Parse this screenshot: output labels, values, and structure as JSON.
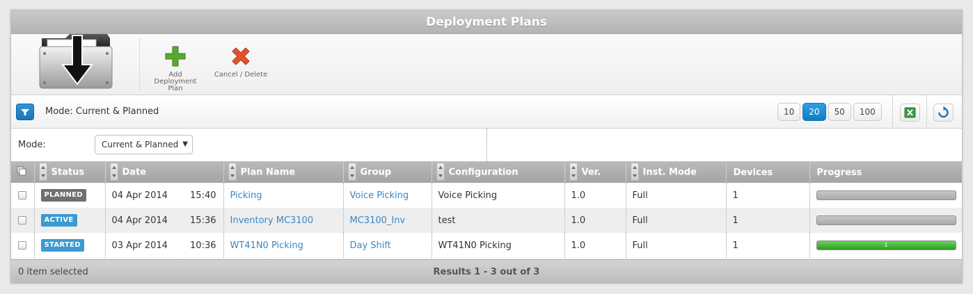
{
  "window": {
    "title": "Deployment Plans"
  },
  "toolbar": {
    "add_label": "Add Deployment Plan",
    "cancel_label": "Cancel / Delete"
  },
  "filter": {
    "mode_text": "Mode: Current & Planned",
    "page_sizes": [
      "10",
      "20",
      "50",
      "100"
    ],
    "active_page_size": "20"
  },
  "mode_filter": {
    "label": "Mode:",
    "selected": "Current & Planned"
  },
  "table": {
    "columns": [
      "Status",
      "Date",
      "Plan Name",
      "Group",
      "Configuration",
      "Ver.",
      "Inst. Mode",
      "Devices",
      "Progress"
    ],
    "rows": [
      {
        "status": "PLANNED",
        "status_color": "#6f6f6f",
        "date": "04 Apr 2014",
        "time": "15:40",
        "plan_name": "Picking",
        "group": "Voice Picking",
        "configuration": "Voice Picking",
        "version": "1.0",
        "inst_mode": "Full",
        "devices": "1",
        "progress": 0,
        "progress_label": ""
      },
      {
        "status": "ACTIVE",
        "status_color": "#3a9bd0",
        "date": "04 Apr 2014",
        "time": "15:36",
        "plan_name": "Inventory MC3100",
        "group": "MC3100_Inv",
        "configuration": "test",
        "version": "1.0",
        "inst_mode": "Full",
        "devices": "1",
        "progress": 0,
        "progress_label": ""
      },
      {
        "status": "STARTED",
        "status_color": "#3a9bd0",
        "date": "03 Apr 2014",
        "time": "10:36",
        "plan_name": "WT41N0 Picking",
        "group": "Day Shift",
        "configuration": "WT41N0 Picking",
        "version": "1.0",
        "inst_mode": "Full",
        "devices": "1",
        "progress": 1.0,
        "progress_label": "1"
      }
    ]
  },
  "footer": {
    "selected_text": "0 item selected",
    "results_text": "Results 1 - 3 out of 3"
  },
  "colors": {
    "accent": "#1b7fc4",
    "link": "#3a87c2",
    "progress_green": "#3fb233"
  }
}
